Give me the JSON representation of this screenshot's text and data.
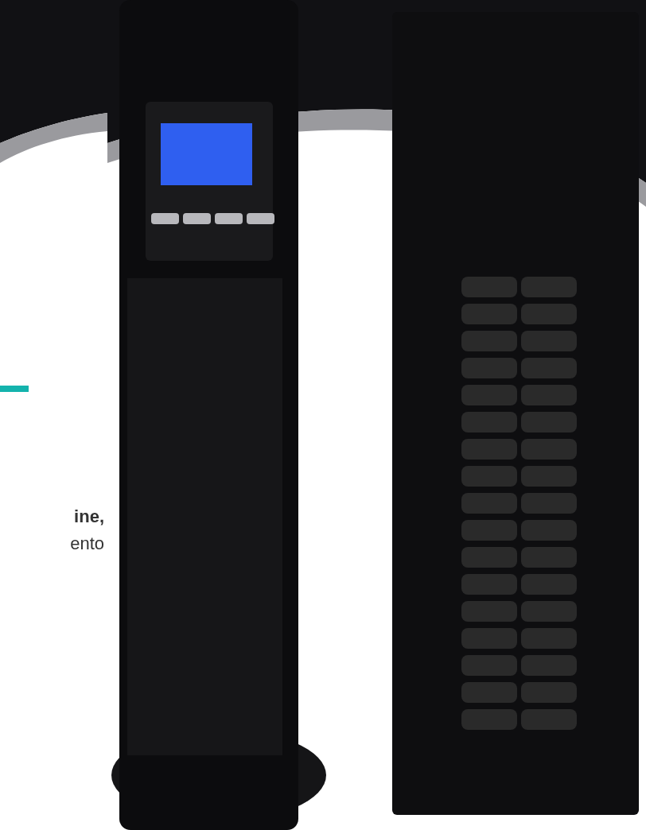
{
  "intro": {
    "lines": [
      {
        "kind": "bold",
        "text": "ine,"
      },
      {
        "kind": "plain",
        "text": "ento"
      }
    ]
  }
}
